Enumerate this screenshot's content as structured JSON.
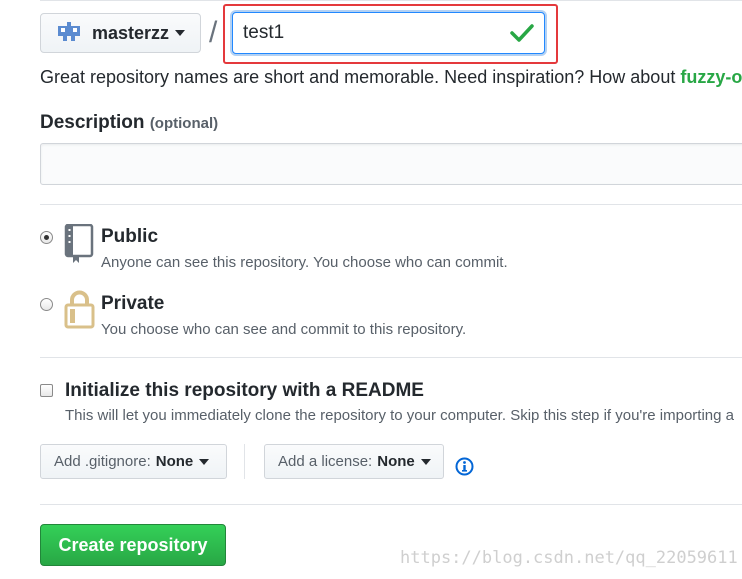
{
  "owner": {
    "name": "masterzz"
  },
  "separator": "/",
  "repo_name": {
    "value": "test1"
  },
  "hint": {
    "text": "Great repository names are short and memorable. Need inspiration? How about ",
    "suggestion": "fuzzy-o"
  },
  "description": {
    "label": "Description",
    "optional": "(optional)",
    "value": ""
  },
  "visibility": [
    {
      "label": "Public",
      "desc": "Anyone can see this repository. You choose who can commit.",
      "selected": true,
      "icon": "repo-book-icon"
    },
    {
      "label": "Private",
      "desc": "You choose who can see and commit to this repository.",
      "selected": false,
      "icon": "lock-icon"
    }
  ],
  "init": {
    "label": "Initialize this repository with a README",
    "desc": "This will let you immediately clone the repository to your computer. Skip this step if you're importing a",
    "checked": false
  },
  "gitignore": {
    "label": "Add .gitignore:",
    "value": "None"
  },
  "license": {
    "label": "Add a license:",
    "value": "None"
  },
  "create_button": "Create repository",
  "watermark": "https://blog.csdn.net/qq_22059611",
  "colors": {
    "primary": "#28a745",
    "link": "#0366d6",
    "highlight": "#e4393c",
    "muted": "#586069"
  }
}
